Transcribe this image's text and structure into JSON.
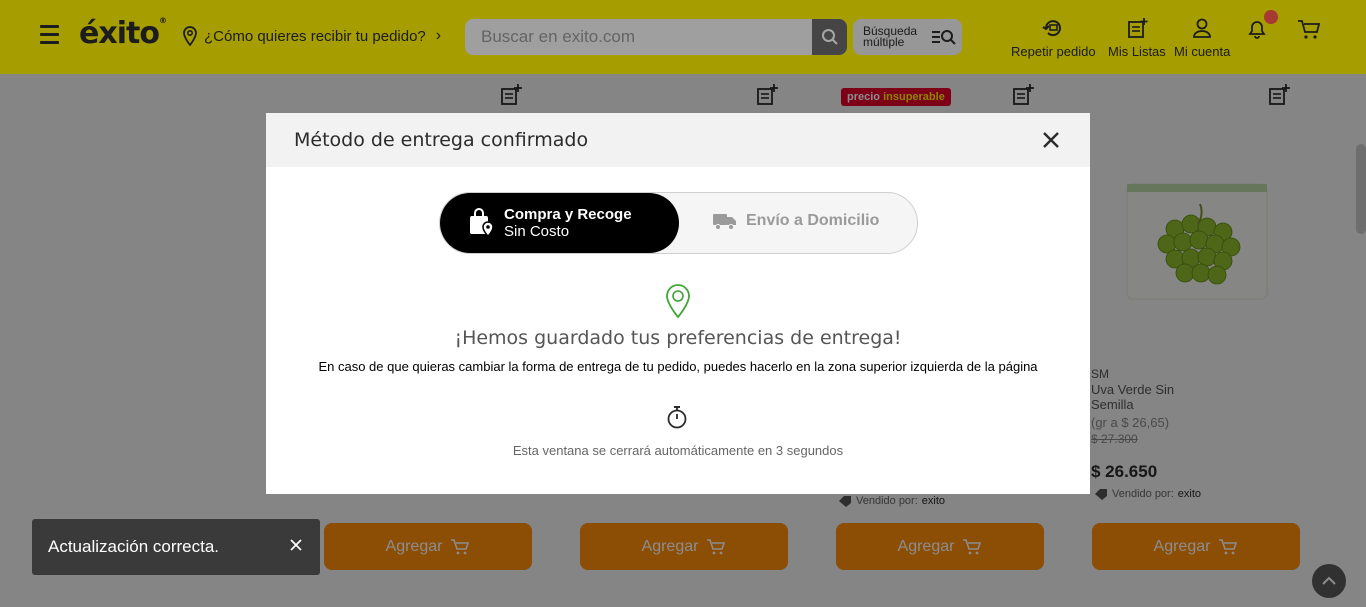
{
  "header": {
    "logo": "éxito",
    "location_prompt": "¿Cómo quieres recibir tu pedido?",
    "search_placeholder": "Buscar en exito.com",
    "multi_search_label": "Búsqueda múltiple",
    "actions": [
      {
        "label": "Repetir pedido",
        "icon": "repeat-order-icon"
      },
      {
        "label": "Mis Listas",
        "icon": "list-icon"
      },
      {
        "label": "Mi cuenta",
        "icon": "user-icon"
      }
    ],
    "brand_color": "#fff200"
  },
  "page": {
    "promo_badge": {
      "part1": "precio",
      "part2": "insuperable"
    },
    "product": {
      "brand": "SM",
      "name": "Uva Verde Sin Semilla",
      "unit_price": "(gr a $ 26,65)",
      "old_price": "$ 27.300",
      "price": "$ 26.650"
    },
    "seller_label": "Vendido por:",
    "seller_name": "exito",
    "add_button_label": "Agregar",
    "accent_color": "#ff8d08"
  },
  "modal": {
    "title": "Método de entrega confirmado",
    "option_active_line1": "Compra y Recoge",
    "option_active_line2": "Sin Costo",
    "option_inactive": "Envío a Domicilio",
    "message_title": "¡Hemos guardado tus preferencias de entrega!",
    "message_body": "En caso de que quieras cambiar la forma de entrega de tu pedido, puedes hacerlo en la zona superior izquierda de la página",
    "auto_close": "Esta ventana se cerrará automáticamente en 3 segundos"
  },
  "toast": {
    "message": "Actualización correcta."
  }
}
